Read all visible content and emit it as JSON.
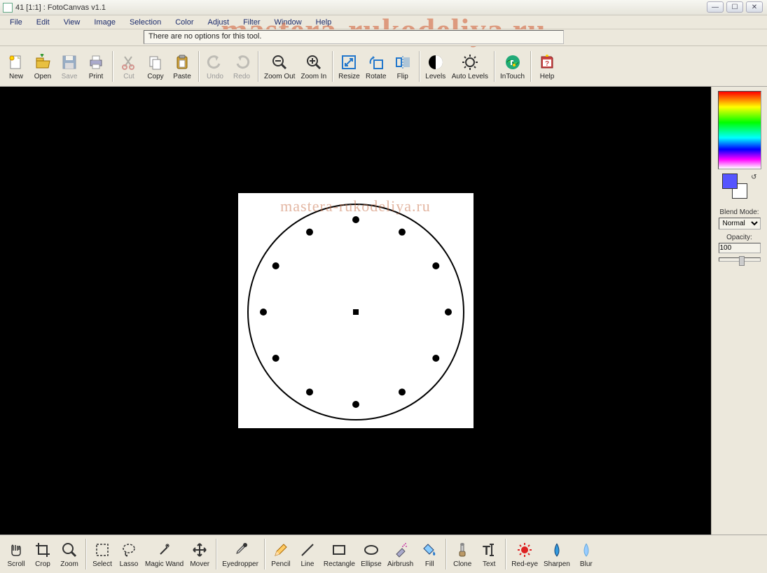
{
  "title": "41 [1:1] : FotoCanvas v1.1",
  "watermark_large": "mastera-rukodeliya.ru",
  "watermark_small": "mastera-rukodeliya.ru",
  "menu": [
    "File",
    "Edit",
    "View",
    "Image",
    "Selection",
    "Color",
    "Adjust",
    "Filter",
    "Window",
    "Help"
  ],
  "options_bar": "There are no options for this tool.",
  "toolbar": [
    {
      "id": "new",
      "label": "New"
    },
    {
      "id": "open",
      "label": "Open"
    },
    {
      "id": "save",
      "label": "Save",
      "disabled": true
    },
    {
      "id": "print",
      "label": "Print"
    },
    {
      "sep": true
    },
    {
      "id": "cut",
      "label": "Cut",
      "disabled": true
    },
    {
      "id": "copy",
      "label": "Copy"
    },
    {
      "id": "paste",
      "label": "Paste"
    },
    {
      "sep": true
    },
    {
      "id": "undo",
      "label": "Undo",
      "disabled": true
    },
    {
      "id": "redo",
      "label": "Redo",
      "disabled": true
    },
    {
      "sep": true
    },
    {
      "id": "zoomout",
      "label": "Zoom Out"
    },
    {
      "id": "zoomin",
      "label": "Zoom In"
    },
    {
      "sep": true
    },
    {
      "id": "resize",
      "label": "Resize"
    },
    {
      "id": "rotate",
      "label": "Rotate"
    },
    {
      "id": "flip",
      "label": "Flip"
    },
    {
      "sep": true
    },
    {
      "id": "levels",
      "label": "Levels"
    },
    {
      "id": "autolevels",
      "label": "Auto Levels"
    },
    {
      "sep": true
    },
    {
      "id": "intouch",
      "label": "InTouch"
    },
    {
      "sep": true
    },
    {
      "id": "help",
      "label": "Help"
    }
  ],
  "bottom_toolbar": [
    {
      "id": "scroll",
      "label": "Scroll"
    },
    {
      "id": "crop",
      "label": "Crop"
    },
    {
      "id": "zoom",
      "label": "Zoom"
    },
    {
      "sep": true
    },
    {
      "id": "select",
      "label": "Select"
    },
    {
      "id": "lasso",
      "label": "Lasso"
    },
    {
      "id": "wand",
      "label": "Magic Wand"
    },
    {
      "id": "mover",
      "label": "Mover"
    },
    {
      "sep": true
    },
    {
      "id": "eyedrop",
      "label": "Eyedropper"
    },
    {
      "sep": true
    },
    {
      "id": "pencil",
      "label": "Pencil"
    },
    {
      "id": "line",
      "label": "Line"
    },
    {
      "id": "rect",
      "label": "Rectangle"
    },
    {
      "id": "ellipse",
      "label": "Ellipse"
    },
    {
      "id": "airbrush",
      "label": "Airbrush"
    },
    {
      "id": "fill",
      "label": "Fill"
    },
    {
      "sep": true
    },
    {
      "id": "clone",
      "label": "Clone"
    },
    {
      "id": "text",
      "label": "Text"
    },
    {
      "sep": true
    },
    {
      "id": "redeye",
      "label": "Red-eye"
    },
    {
      "id": "sharpen",
      "label": "Sharpen"
    },
    {
      "id": "blur",
      "label": "Blur"
    }
  ],
  "right_panel": {
    "blend_label": "Blend Mode:",
    "blend_value": "Normal",
    "opacity_label": "Opacity:",
    "opacity_value": "100",
    "fg_color": "#5522ff",
    "bg_color": "#ffffff"
  }
}
